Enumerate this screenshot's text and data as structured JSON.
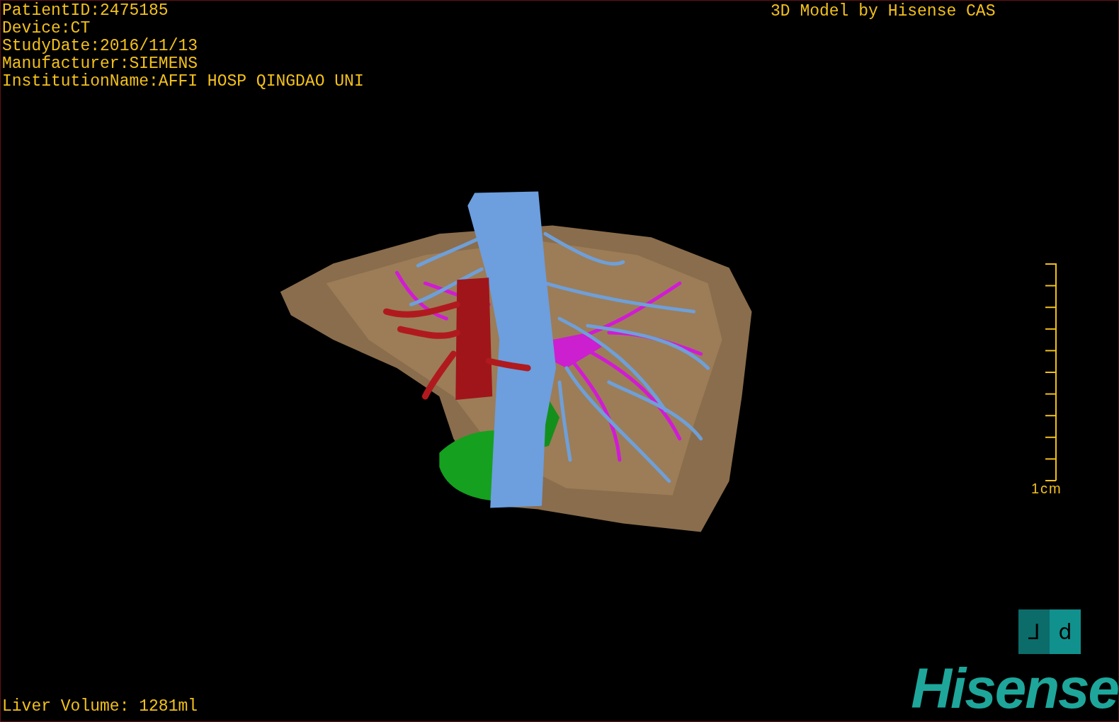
{
  "info_lines": [
    "PatientID:2475185",
    "Device:CT",
    "StudyDate:2016/11/13",
    "Manufacturer:SIEMENS",
    "InstitutionName:AFFI HOSP QINGDAO UNI"
  ],
  "title": "3D Model by Hisense CAS",
  "scale": {
    "label": "1cm"
  },
  "orientation_cube": {
    "faces": [
      "⅃",
      "d"
    ]
  },
  "liver_volume": "Liver Volume: 1281ml",
  "logo": "Hisense"
}
